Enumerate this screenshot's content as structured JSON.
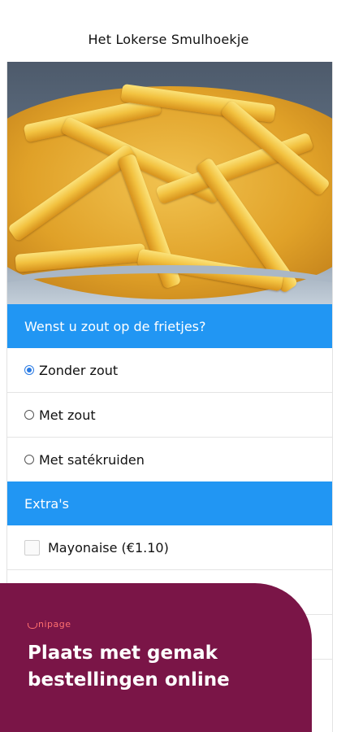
{
  "header": {
    "title": "Het Lokerse Smulhoekje"
  },
  "product": {
    "image": "fries-photo"
  },
  "salt_section": {
    "title": "Wenst u zout op de frietjes?",
    "options": [
      {
        "label": "Zonder zout",
        "selected": true
      },
      {
        "label": "Met zout",
        "selected": false
      },
      {
        "label": "Met satékruiden",
        "selected": false
      }
    ]
  },
  "extras_section": {
    "title": "Extra's",
    "items": [
      {
        "label": "Mayonaise (€1.10)",
        "checked": false
      }
    ]
  },
  "banner": {
    "brand": "nipage",
    "headline_line1": "Plaats met gemak",
    "headline_line2": "bestellingen online"
  },
  "colors": {
    "section_header": "#2196f3",
    "banner_bg": "#7a1547",
    "brand_accent": "#ff6f6f"
  }
}
